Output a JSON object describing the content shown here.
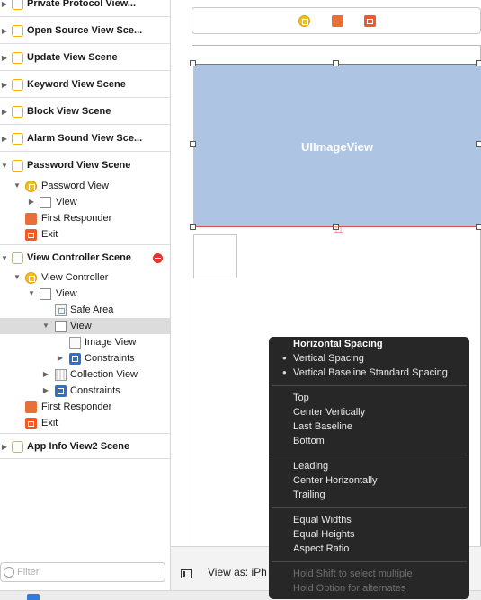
{
  "outline": {
    "items": [
      {
        "label": "Private Protocol View...",
        "type": "scene",
        "collapsed": true
      },
      {
        "label": "Open Source View Sce...",
        "type": "scene",
        "collapsed": true
      },
      {
        "label": "Update View Scene",
        "type": "scene",
        "collapsed": true
      },
      {
        "label": "Keyword View Scene",
        "type": "scene",
        "collapsed": true
      },
      {
        "label": "Block View Scene",
        "type": "scene",
        "collapsed": true
      },
      {
        "label": "Alarm Sound View Sce...",
        "type": "scene",
        "collapsed": true
      },
      {
        "label": "Password View Scene",
        "type": "scene",
        "collapsed": false
      },
      {
        "label": "Password View",
        "type": "view-controller"
      },
      {
        "label": "View",
        "type": "view"
      },
      {
        "label": "First Responder",
        "type": "first-responder"
      },
      {
        "label": "Exit",
        "type": "exit"
      },
      {
        "label": "View Controller Scene",
        "type": "scene",
        "collapsed": false,
        "has_error": true
      },
      {
        "label": "View Controller",
        "type": "view-controller"
      },
      {
        "label": "View",
        "type": "view"
      },
      {
        "label": "Safe Area",
        "type": "safe-area"
      },
      {
        "label": "View",
        "type": "view",
        "selected": true
      },
      {
        "label": "Image View",
        "type": "image-view"
      },
      {
        "label": "Constraints",
        "type": "constraints"
      },
      {
        "label": "Collection View",
        "type": "collection-view"
      },
      {
        "label": "Constraints",
        "type": "constraints"
      },
      {
        "label": "First Responder",
        "type": "first-responder"
      },
      {
        "label": "Exit",
        "type": "exit"
      },
      {
        "label": "App Info View2 Scene",
        "type": "scene",
        "collapsed": true
      }
    ],
    "filter_placeholder": "Filter"
  },
  "canvas": {
    "imageview_label": "UIImageView",
    "view_as_label": "View as: iPh"
  },
  "menu": {
    "items": [
      {
        "label": "Horizontal Spacing",
        "style": "head"
      },
      {
        "label": "Vertical Spacing",
        "style": "bullet"
      },
      {
        "label": "Vertical Baseline Standard Spacing",
        "style": "bullet"
      },
      {
        "label": "Top"
      },
      {
        "label": "Center Vertically"
      },
      {
        "label": "Last Baseline"
      },
      {
        "label": "Bottom"
      },
      {
        "label": "Leading"
      },
      {
        "label": "Center Horizontally"
      },
      {
        "label": "Trailing"
      },
      {
        "label": "Equal Widths"
      },
      {
        "label": "Equal Heights"
      },
      {
        "label": "Aspect Ratio"
      },
      {
        "label": "Hold Shift to select multiple",
        "style": "dim"
      },
      {
        "label": "Hold Option for alternates",
        "style": "dim"
      }
    ]
  },
  "colors": {
    "selection_outline": "#dcdcdc",
    "imageview_fill": "#aec4e3",
    "constraint_red": "#e24b4b",
    "menu_bg": "#1e1e1e",
    "scene_icon_yellow": "#f3be1f",
    "exit_orange": "#f05a24",
    "constraints_blue": "#2e6fd3"
  },
  "icons": {
    "scene": "scene-icon",
    "view_controller": "view-controller-icon",
    "view": "view-icon",
    "safe_area": "safe-area-icon",
    "image_view": "image-view-icon",
    "constraints": "constraints-icon",
    "collection_view": "collection-view-icon",
    "first_responder": "first-responder-icon",
    "exit": "exit-icon",
    "error": "error-badge-icon",
    "filter": "filter-icon",
    "panel_toggle": "panel-toggle-icon"
  }
}
